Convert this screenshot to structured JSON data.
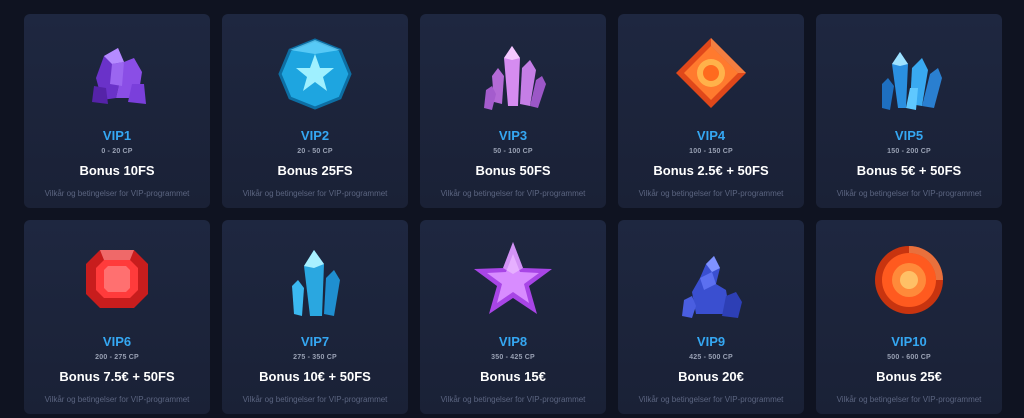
{
  "cards": [
    {
      "level": "VIP1",
      "range": "0 - 20 CP",
      "bonus": "Bonus 10FS",
      "terms": "Vilkår og betingelser for VIP-programmet",
      "gem": "purple-crystal-cluster-icon"
    },
    {
      "level": "VIP2",
      "range": "20 - 50 CP",
      "bonus": "Bonus 25FS",
      "terms": "Vilkår og betingelser for VIP-programmet",
      "gem": "blue-star-gem-icon"
    },
    {
      "level": "VIP3",
      "range": "50 - 100 CP",
      "bonus": "Bonus 50FS",
      "terms": "Vilkår og betingelser for VIP-programmet",
      "gem": "pink-crystal-icon"
    },
    {
      "level": "VIP4",
      "range": "100 - 150 CP",
      "bonus": "Bonus 2.5€ + 50FS",
      "terms": "Vilkår og betingelser for VIP-programmet",
      "gem": "orange-diamond-gem-icon"
    },
    {
      "level": "VIP5",
      "range": "150 - 200 CP",
      "bonus": "Bonus 5€ + 50FS",
      "terms": "Vilkår og betingelser for VIP-programmet",
      "gem": "blue-crystal-cluster-icon"
    },
    {
      "level": "VIP6",
      "range": "200 - 275 CP",
      "bonus": "Bonus 7.5€ + 50FS",
      "terms": "Vilkår og betingelser for VIP-programmet",
      "gem": "red-octagon-gem-icon"
    },
    {
      "level": "VIP7",
      "range": "275 - 350 CP",
      "bonus": "Bonus 10€ + 50FS",
      "terms": "Vilkår og betingelser for VIP-programmet",
      "gem": "cyan-crystal-icon"
    },
    {
      "level": "VIP8",
      "range": "350 - 425 CP",
      "bonus": "Bonus 15€",
      "terms": "Vilkår og betingelser for VIP-programmet",
      "gem": "purple-star-icon"
    },
    {
      "level": "VIP9",
      "range": "425 - 500 CP",
      "bonus": "Bonus 20€",
      "terms": "Vilkår og betingelser for VIP-programmet",
      "gem": "blue-rock-crystal-icon"
    },
    {
      "level": "VIP10",
      "range": "500 - 600 CP",
      "bonus": "Bonus 25€",
      "terms": "Vilkår og betingelser for VIP-programmet",
      "gem": "orange-round-gem-icon"
    }
  ],
  "colors": {
    "background": "#0f1321",
    "card": "#1e2740",
    "level": "#35a7f2",
    "range": "#98a0b3",
    "bonus": "#ffffff",
    "terms": "#5b6580"
  }
}
